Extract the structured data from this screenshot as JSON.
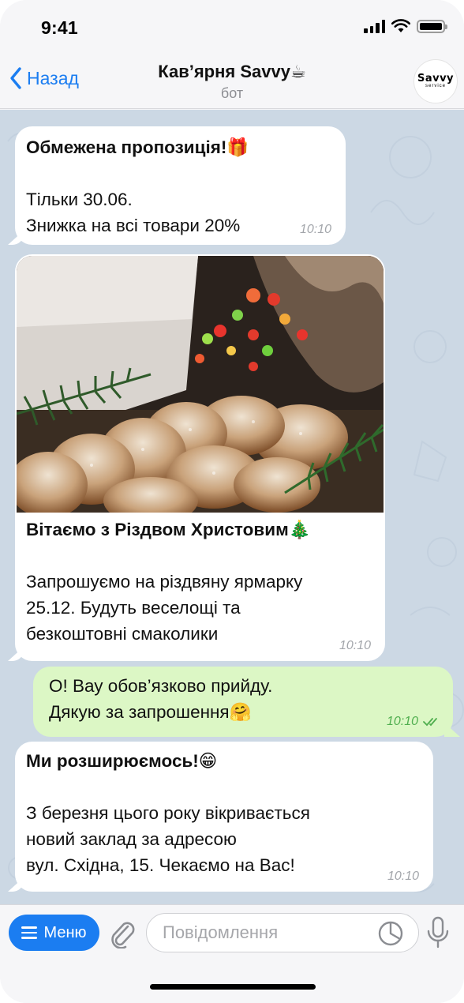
{
  "status_bar": {
    "time": "9:41"
  },
  "header": {
    "back_label": "Назад",
    "title": "Кав’ярня Savvy☕",
    "subtitle": "бот",
    "avatar_logo": "Savvy",
    "avatar_sub": "service"
  },
  "messages": [
    {
      "direction": "incoming",
      "title": "Обмежена пропозиція!🎁",
      "lines": [
        "Тільки 30.06.",
        "Знижка на всі товари  20%"
      ],
      "time": "10:10"
    },
    {
      "direction": "incoming",
      "has_photo": true,
      "title": "Вітаємо з Різдвом Христовим🎄",
      "lines": [
        "Запрошуємо на різдвяну ярмарку",
        "25.12. Будуть веселощі та",
        "безкоштовні смаколики"
      ],
      "time": "10:10"
    },
    {
      "direction": "outgoing",
      "lines": [
        "О! Вау обов’язково прийду.",
        "Дякую за запрошення🤗"
      ],
      "time": "10:10",
      "read": true
    },
    {
      "direction": "incoming",
      "title": "Ми розширюємось!😁",
      "lines": [
        "З березня цього року вікривається",
        "новий заклад за адресою",
        "вул. Східна, 15. Чекаємо на Вас!"
      ],
      "time": "10:10"
    }
  ],
  "input_bar": {
    "menu_label": "Меню",
    "placeholder": "Повідомлення"
  },
  "colors": {
    "accent": "#1b7df1",
    "chat_background": "#ccd8e4",
    "outgoing_bubble": "#dcf7c5",
    "read_check": "#4fae4e"
  }
}
